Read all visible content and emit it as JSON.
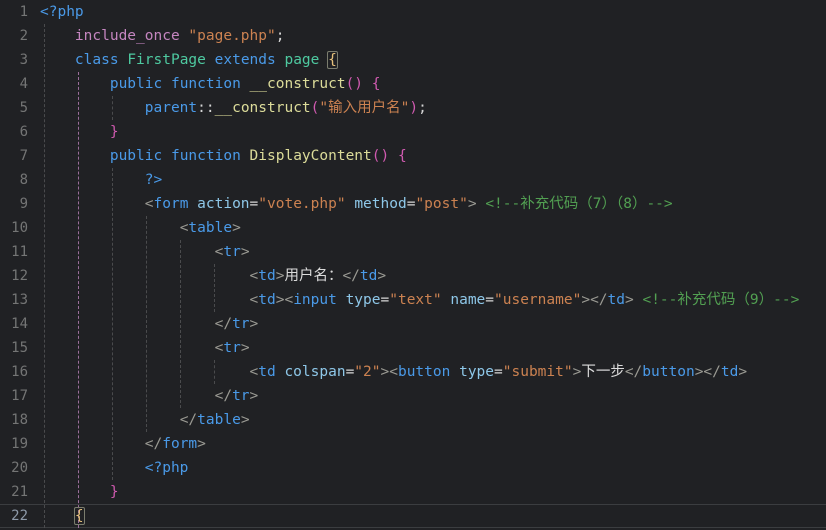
{
  "editor": {
    "background": "#202124",
    "line_count": 22,
    "active_line": 22,
    "font_size_px": 14.5,
    "line_height_px": 24
  },
  "colors": {
    "background": "#202124",
    "line_number": "#747575",
    "line_number_active": "#8d99a8",
    "keyword": "#4a9ae8",
    "control_keyword": "#c586c0",
    "class_name": "#4ec9a0",
    "function_name": "#dcdc9a",
    "string": "#cc8251",
    "comment": "#52a052",
    "tag_name": "#4a9ae8",
    "attribute_name": "#8ec7e8",
    "tag_bracket": "#9a9a93",
    "paren": "#d05ab0",
    "brace_yellow": "#e5c07b",
    "plain_text": "#d6d6d6",
    "indent_guide": "#4a4b4d",
    "indent_guide_active": "#9b6f9b"
  },
  "line_numbers": [
    "1",
    "2",
    "3",
    "4",
    "5",
    "6",
    "7",
    "8",
    "9",
    "10",
    "11",
    "12",
    "13",
    "14",
    "15",
    "16",
    "17",
    "18",
    "19",
    "20",
    "21",
    "22"
  ],
  "lines": [
    {
      "num": "1",
      "indent": 0,
      "text": "<?php"
    },
    {
      "num": "2",
      "indent": 1,
      "text": "include_once \"page.php\";"
    },
    {
      "num": "3",
      "indent": 1,
      "text": "class FirstPage extends page {"
    },
    {
      "num": "4",
      "indent": 2,
      "text": "public function __construct() {"
    },
    {
      "num": "5",
      "indent": 3,
      "text": "parent::__construct(\"输入用户名\");"
    },
    {
      "num": "6",
      "indent": 2,
      "text": "}"
    },
    {
      "num": "7",
      "indent": 2,
      "text": "public function DisplayContent() {"
    },
    {
      "num": "8",
      "indent": 3,
      "text": "?>"
    },
    {
      "num": "9",
      "indent": 3,
      "text": "<form action=\"vote.php\" method=\"post\"> <!--补充代码（7）（8）-->"
    },
    {
      "num": "10",
      "indent": 4,
      "text": "<table>"
    },
    {
      "num": "11",
      "indent": 5,
      "text": "<tr>"
    },
    {
      "num": "12",
      "indent": 6,
      "text": "<td>用户名：</td>"
    },
    {
      "num": "13",
      "indent": 6,
      "text": "<td><input type=\"text\" name=\"username\"></td> <!--补充代码（9）-->"
    },
    {
      "num": "14",
      "indent": 5,
      "text": "</tr>"
    },
    {
      "num": "15",
      "indent": 5,
      "text": "<tr>"
    },
    {
      "num": "16",
      "indent": 6,
      "text": "<td colspan=\"2\"><button type=\"submit\">下一步</button></td>"
    },
    {
      "num": "17",
      "indent": 5,
      "text": "</tr>"
    },
    {
      "num": "18",
      "indent": 4,
      "text": "</table>"
    },
    {
      "num": "19",
      "indent": 3,
      "text": "</form>"
    },
    {
      "num": "20",
      "indent": 3,
      "text": "<?php"
    },
    {
      "num": "21",
      "indent": 2,
      "text": "}"
    },
    {
      "num": "22",
      "indent": 1,
      "text": "}"
    }
  ],
  "comments": [
    "<!--补充代码（7）（8）-->",
    "<!--补充代码（9）-->"
  ],
  "strings": [
    "page.php",
    "输入用户名",
    "vote.php",
    "post",
    "text",
    "username",
    "2",
    "submit"
  ],
  "chinese_text": [
    "输入用户名",
    "用户名：",
    "下一步",
    "补充代码"
  ],
  "identifiers": [
    "FirstPage",
    "page",
    "__construct",
    "DisplayContent",
    "parent"
  ],
  "html_tags": [
    "form",
    "table",
    "tr",
    "td",
    "input",
    "button"
  ],
  "attributes": [
    "action",
    "method",
    "type",
    "name",
    "colspan"
  ],
  "bracket_match": {
    "open_line": "3",
    "close_line": "22",
    "glyph": "{"
  }
}
